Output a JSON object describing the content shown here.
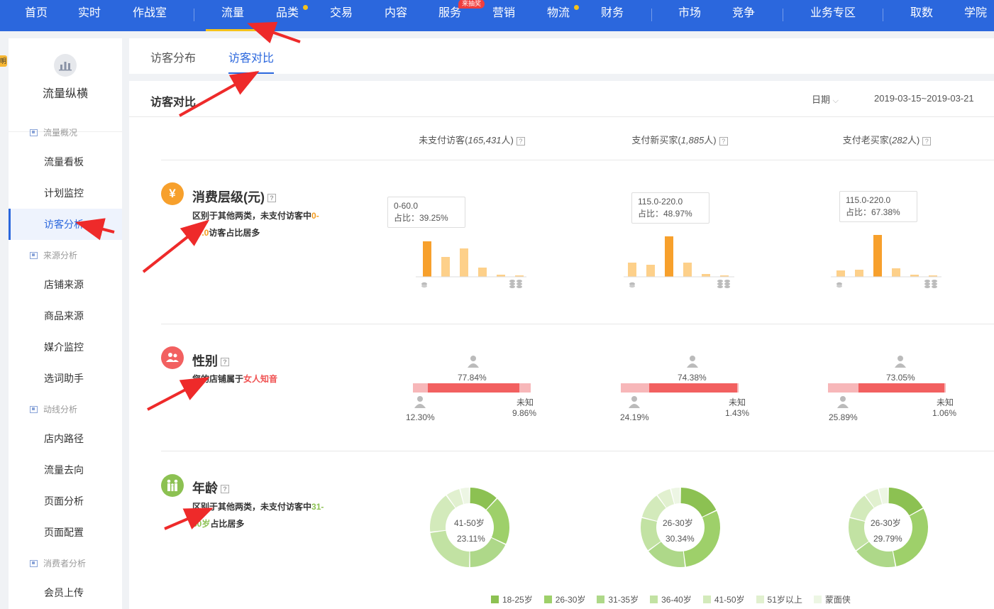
{
  "nav": {
    "items": [
      "首页",
      "实时",
      "作战室",
      "流量",
      "品类",
      "交易",
      "内容",
      "服务",
      "营销",
      "物流",
      "财务",
      "市场",
      "竞争",
      "业务专区",
      "取数",
      "学院"
    ],
    "active": "流量",
    "service_badge": "来抽奖"
  },
  "sidebar": {
    "title": "流量纵横",
    "groups": [
      "流量概况",
      "来源分析",
      "动线分析",
      "消费者分析"
    ],
    "items": [
      "流量看板",
      "计划监控",
      "访客分析",
      "店铺来源",
      "商品来源",
      "媒介监控",
      "选词助手",
      "店内路径",
      "流量去向",
      "页面分析",
      "页面配置",
      "会员上传"
    ],
    "side_tab": "明"
  },
  "tabs": [
    "访客分布",
    "访客对比"
  ],
  "main": {
    "title": "访客对比",
    "date_label": "日期",
    "date_range": "2019-03-15~2019-03-21",
    "columns": [
      {
        "name": "未支付访客",
        "count": "165,431",
        "unit": "人"
      },
      {
        "name": "支付新买家",
        "count": "1,885",
        "unit": "人"
      },
      {
        "name": "支付老买家",
        "count": "282",
        "unit": "人"
      }
    ],
    "qmark": "?"
  },
  "sections": {
    "spend": {
      "icon": "¥",
      "title": "消费层级(元)",
      "desc_prefix": "区别于其他两类，未支付访客中",
      "desc_highlight": "0-60.0",
      "desc_suffix": "访客占比居多",
      "tooltips": [
        {
          "range": "0-60.0",
          "share": "占比：39.25%"
        },
        {
          "range": "115.0-220.0",
          "share": "占比：48.97%"
        },
        {
          "range": "115.0-220.0",
          "share": "占比：67.38%"
        }
      ]
    },
    "gender": {
      "title": "性别",
      "desc_prefix": "您的店铺属于",
      "desc_highlight": "女人知音",
      "unknown_label": "未知",
      "columns": [
        {
          "female": "77.84%",
          "male": "12.30%",
          "unknown": "9.86%"
        },
        {
          "female": "74.38%",
          "male": "24.19%",
          "unknown": "1.43%"
        },
        {
          "female": "73.05%",
          "male": "25.89%",
          "unknown": "1.06%"
        }
      ]
    },
    "age": {
      "title": "年龄",
      "desc_prefix": "区别于其他两类，未支付访客中",
      "desc_highlight": "31-50岁",
      "desc_suffix": "占比居多",
      "donuts": [
        {
          "label": "41-50岁",
          "value": "23.11%"
        },
        {
          "label": "26-30岁",
          "value": "30.34%"
        },
        {
          "label": "26-30岁",
          "value": "29.79%"
        }
      ],
      "legend": [
        "18-25岁",
        "26-30岁",
        "31-35岁",
        "36-40岁",
        "41-50岁",
        "51岁以上",
        "蒙面侠"
      ]
    }
  },
  "colors": {
    "nav_bg": "#2b67dd",
    "accent_yellow": "#f5c21b",
    "bar_main": "#f7a02c",
    "bar_light": "#fdd08a",
    "female_bar": "#f26060",
    "male_bar": "#f7b7b9",
    "age_greens": [
      "#8cc152",
      "#9ed06a",
      "#aed889",
      "#c2e2a3",
      "#d3eabb",
      "#e1f0cf",
      "#edf6e4"
    ],
    "annotation_red": "#ee2a2a"
  }
}
